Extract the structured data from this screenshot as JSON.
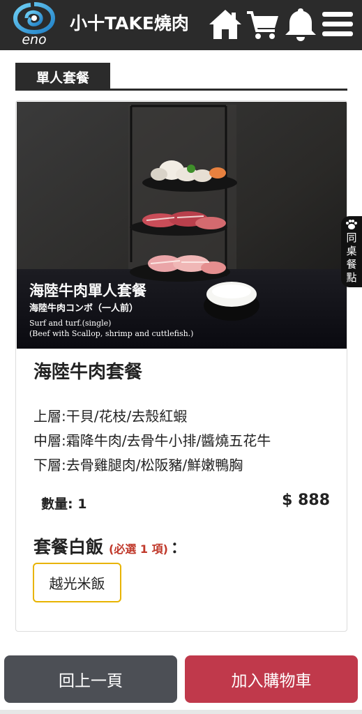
{
  "header": {
    "logo_text": "eno",
    "title": "小十TAKE燒肉",
    "icons": [
      "home-icon",
      "cart-icon",
      "bell-icon",
      "menu-icon"
    ],
    "background": "#2b2b2b"
  },
  "section": {
    "tab_label": "單人套餐"
  },
  "product": {
    "photo_caption": {
      "title_zh": "海陸牛肉單人套餐",
      "title_jp": "海陸牛肉コンボ（一人前）",
      "line_en_1": "Surf and turf.(single)",
      "line_en_2": "(Beef with Scallop, shrimp and cuttlefish.)"
    },
    "name": "海陸牛肉套餐",
    "description": [
      "上層:干貝/花枝/去殼紅蝦",
      "中層:霜降牛肉/去骨牛小排/醬燒五花牛",
      "下層:去骨雞腿肉/松阪豬/鮮嫩鴨胸"
    ],
    "quantity_label": "數量: 1",
    "price": "$ 888"
  },
  "rice": {
    "title": "套餐白飯",
    "required": "(必選 1 項)",
    "colon": "：",
    "options": [
      "越光米飯"
    ],
    "selected_color": "#e8b400"
  },
  "side_tab": {
    "label": "同桌餐點",
    "icon": "paw-icon"
  },
  "buttons": {
    "back": "回上一頁",
    "add_to_cart": "加入購物車",
    "back_color": "#4c4f55",
    "add_color": "#c0394b"
  }
}
